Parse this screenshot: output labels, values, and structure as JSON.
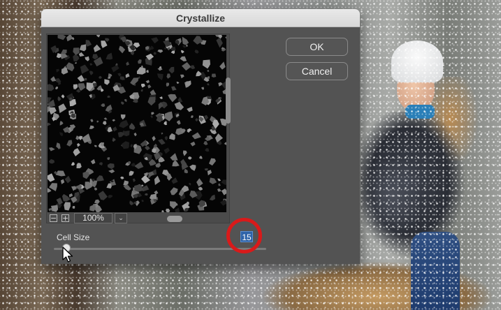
{
  "dialog": {
    "title": "Crystallize",
    "ok_label": "OK",
    "cancel_label": "Cancel"
  },
  "preview": {
    "zoom_out": "−",
    "zoom_in": "+",
    "zoom_level": "100%",
    "zoom_dropdown": "⌄"
  },
  "cell_size": {
    "label": "Cell Size",
    "value": "15",
    "slider_fraction": 0.05
  },
  "colors": {
    "dialog_bg": "#535353",
    "highlight": "#d91a1a",
    "selection": "#2f63a8"
  }
}
